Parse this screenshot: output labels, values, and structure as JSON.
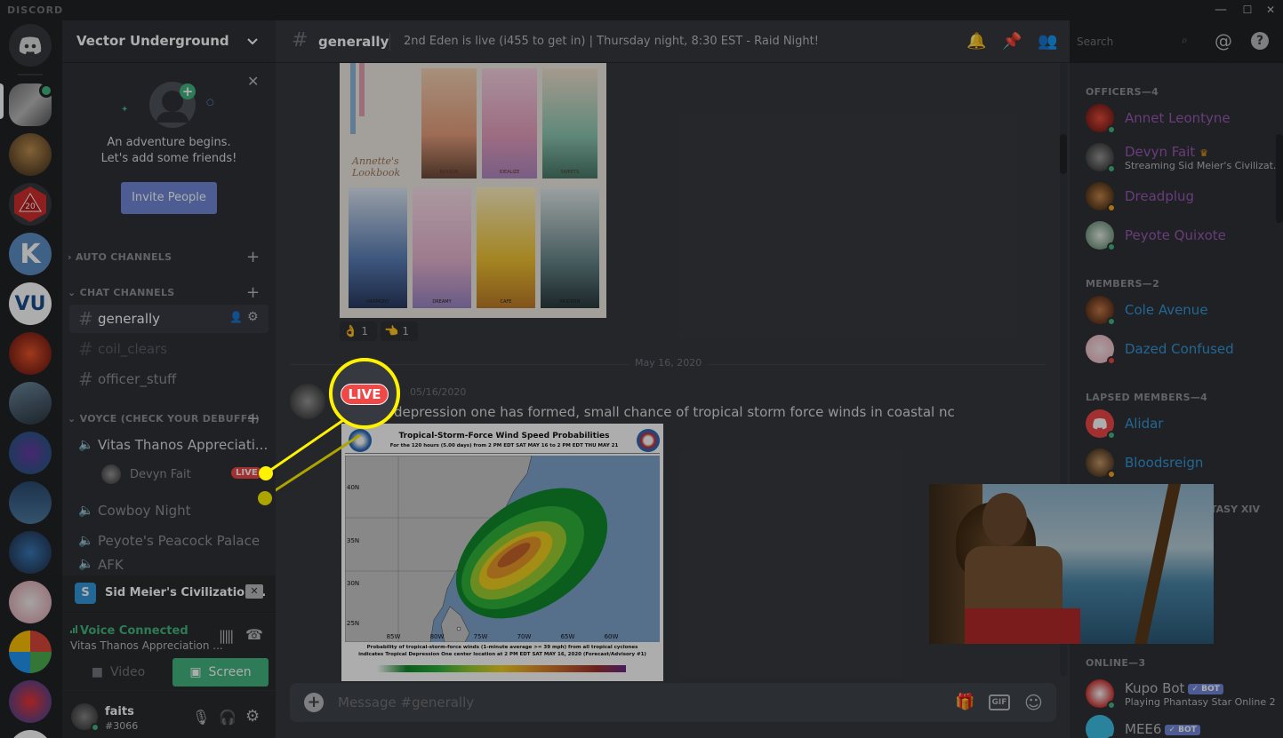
{
  "titlebar": {
    "brand": "DISCORD",
    "min": "—",
    "max": "☐",
    "close": "✕"
  },
  "guild": {
    "name": "Vector Underground"
  },
  "onboarding": {
    "line1": "An adventure begins.",
    "line2": "Let's add some friends!",
    "invite_label": "Invite People"
  },
  "categories": {
    "auto": "AUTO CHANNELS",
    "chat": "CHAT CHANNELS",
    "voice": "VOYCE (CHECK YOUR DEBUFFS)"
  },
  "chat_channels": [
    {
      "name": "generally"
    },
    {
      "name": "coil_clears"
    },
    {
      "name": "officer_stuff"
    }
  ],
  "voice_channels": [
    {
      "name": "Vitas Thanos Appreciati..."
    },
    {
      "name": "Cowboy Night"
    },
    {
      "name": "Peyote's Peacock Palace"
    },
    {
      "name": "AFK"
    }
  ],
  "voice_user": {
    "name": "Devyn Fait",
    "badge": "LIVE"
  },
  "stream_panel": {
    "title": "Sid Meier's Civilization..."
  },
  "voice_panel": {
    "status": "Voice Connected",
    "channel": "Vitas Thanos Appreciation ...",
    "video_label": "Video",
    "screen_label": "Screen"
  },
  "user": {
    "name": "faits",
    "tag": "#3066"
  },
  "header": {
    "channel": "generally",
    "topic": "2nd Eden is live (i455 to get in) | Thursday night, 8:30 EST - Raid Night!",
    "search_placeholder": "Search"
  },
  "messages": {
    "reactions": [
      {
        "emoji": "👌",
        "count": "1"
      },
      {
        "emoji": "👈",
        "count": "1"
      }
    ],
    "divider": "May 16, 2020",
    "timestamp": "05/16/2020",
    "text": "tropical depression one has formed, small chance of tropical storm force winds in coastal nc",
    "callout": "LIVE"
  },
  "lookbook": {
    "title": "Annette's Lookbook",
    "tags": [
      "REASON",
      "IDEALIZE",
      "SWEETS",
      "HARMONY",
      "DREAMY",
      "CAFE",
      "MODERN"
    ]
  },
  "map": {
    "title": "Tropical-Storm-Force Wind Speed Probabilities",
    "subtitle": "For the 120 hours (5.00 days) from 2 PM EDT SAT MAY 16 to 2 PM EDT THU MAY 21",
    "lat_labels": [
      "40N",
      "35N",
      "30N",
      "25N"
    ],
    "lon_labels": [
      "85W",
      "80W",
      "75W",
      "70W",
      "65W",
      "60W"
    ],
    "footer1": "Probability of tropical-storm-force winds (1-minute average >= 39 mph) from all tropical cyclones",
    "footer2": "indicates Tropical Depression One center location at 2 PM EDT SAT MAY 16, 2020 (Forecast/Advisory #1)"
  },
  "composer": {
    "placeholder": "Message #generally",
    "gif": "GIF"
  },
  "members": {
    "groups": [
      {
        "label": "OFFICERS—4",
        "items": [
          {
            "name": "Annet Leontyne",
            "color": "#9b59b6",
            "sub": ""
          },
          {
            "name": "Devyn Fait",
            "color": "#9b59b6",
            "sub": "Streaming Sid Meier's Civilizat..."
          },
          {
            "name": "Dreadplug",
            "color": "#9b59b6",
            "sub": ""
          },
          {
            "name": "Peyote Quixote",
            "color": "#9b59b6",
            "sub": ""
          }
        ]
      },
      {
        "label": "MEMBERS—2",
        "items": [
          {
            "name": "Cole Avenue",
            "color": "#3498db",
            "sub": ""
          },
          {
            "name": "Dazed Confused",
            "color": "#3498db",
            "sub": ""
          }
        ]
      },
      {
        "label": "LAPSED MEMBERS—4",
        "items": [
          {
            "name": "Alidar",
            "color": "#3498db",
            "sub": ""
          },
          {
            "name": "Bloodsreign",
            "color": "#3498db",
            "sub": ""
          }
        ]
      },
      {
        "label": "ONLINE—3",
        "items": [
          {
            "name": "Kupo Bot",
            "color": "#b9bbbe",
            "sub": "Playing Phantasy Star Online 2",
            "bot": "✓ BOT"
          },
          {
            "name": "MEE6",
            "color": "#b9bbbe",
            "sub": "",
            "bot": "✓ BOT"
          }
        ]
      }
    ],
    "hidden_group_fragment": "TASY XIV"
  },
  "colors": {
    "accent": "#7289da",
    "online": "#43b581",
    "live": "#f04747",
    "callout": "#fff200",
    "screen_btn": "#43b581"
  }
}
